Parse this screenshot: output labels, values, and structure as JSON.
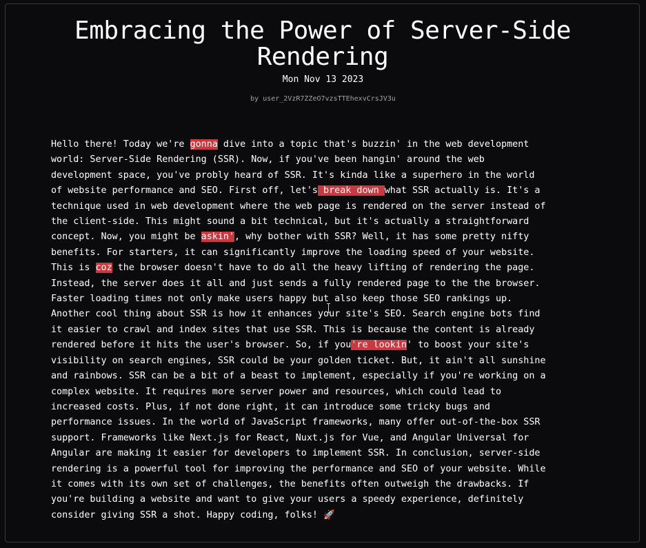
{
  "article": {
    "title": "Embracing the Power of Server-Side Rendering",
    "date": "Mon Nov 13 2023",
    "author": "by user_2VzR7ZZeO7vzsTTEhexvCrsJV3u",
    "highlight_color": "#c9393f",
    "body_lines": [
      [
        {
          "t": "Hello there! Today we're "
        },
        {
          "t": "gonna",
          "hl": true
        },
        {
          "t": " dive into a topic that's buzzin' in the web development"
        }
      ],
      [
        {
          "t": "world: Server-Side Rendering (SSR). Now, if you've been hangin' around the web"
        }
      ],
      [
        {
          "t": "development space, you've probly heard of SSR. It's kinda like a superhero in the world"
        }
      ],
      [
        {
          "t": "of website performance and SEO. First off, let's"
        },
        {
          "t": " break down ",
          "hl": true
        },
        {
          "t": "what SSR actually is. It's a"
        }
      ],
      [
        {
          "t": "technique used in web development where the web page is rendered on the server instead of"
        }
      ],
      [
        {
          "t": "the client-side. This might sound a bit technical, but it's actually a straightforward"
        }
      ],
      [
        {
          "t": "concept. Now, you might be "
        },
        {
          "t": "askin'",
          "hl": true
        },
        {
          "t": ", why bother with SSR? Well, it has some pretty nifty"
        }
      ],
      [
        {
          "t": "benefits. For starters, it can significantly improve the loading speed of your website."
        }
      ],
      [
        {
          "t": "This is "
        },
        {
          "t": "coz",
          "hl": true
        },
        {
          "t": " the browser doesn't have to do all the heavy lifting of rendering the page."
        }
      ],
      [
        {
          "t": "Instead, the server does it all and just sends a fully rendered page to the the browser."
        }
      ],
      [
        {
          "t": "Faster loading times not only make users happy but also keep those SEO rankings up."
        }
      ],
      [
        {
          "t": "Another cool thing about SSR is how it enhances your site's SEO. Search engine bots find"
        }
      ],
      [
        {
          "t": "it easier to crawl and index sites that use SSR. This is because the content is already"
        }
      ],
      [
        {
          "t": "rendered before it hits the user's browser. So, if you"
        },
        {
          "t": "'re lookin",
          "hl": true
        },
        {
          "t": "' to boost your site's"
        }
      ],
      [
        {
          "t": "visibility on search engines, SSR could be your golden ticket. But, it ain't all sunshine"
        }
      ],
      [
        {
          "t": "and rainbows. SSR can be a bit of a beast to implement, especially if you're working on a"
        }
      ],
      [
        {
          "t": "complex website. It requires more server power and resources, which could lead to"
        }
      ],
      [
        {
          "t": "increased costs. Plus, if not done right, it can introduce some tricky bugs and"
        }
      ],
      [
        {
          "t": "performance issues. In the world of JavaScript frameworks, many offer out-of-the-box SSR"
        }
      ],
      [
        {
          "t": "support. Frameworks like Next.js for React, Nuxt.js for Vue, and Angular Universal for"
        }
      ],
      [
        {
          "t": "Angular are making it easier for developers to implement SSR. In conclusion, server-side"
        }
      ],
      [
        {
          "t": "rendering is a powerful tool for improving the performance and SEO of your website. While"
        }
      ],
      [
        {
          "t": "it comes with its own set of challenges, the benefits often outweigh the drawbacks. If"
        }
      ],
      [
        {
          "t": "you're building a website and want to give your users a speedy experience, definitely"
        }
      ],
      [
        {
          "t": "consider giving SSR a shot. Happy coding, folks! 🚀"
        }
      ]
    ]
  }
}
